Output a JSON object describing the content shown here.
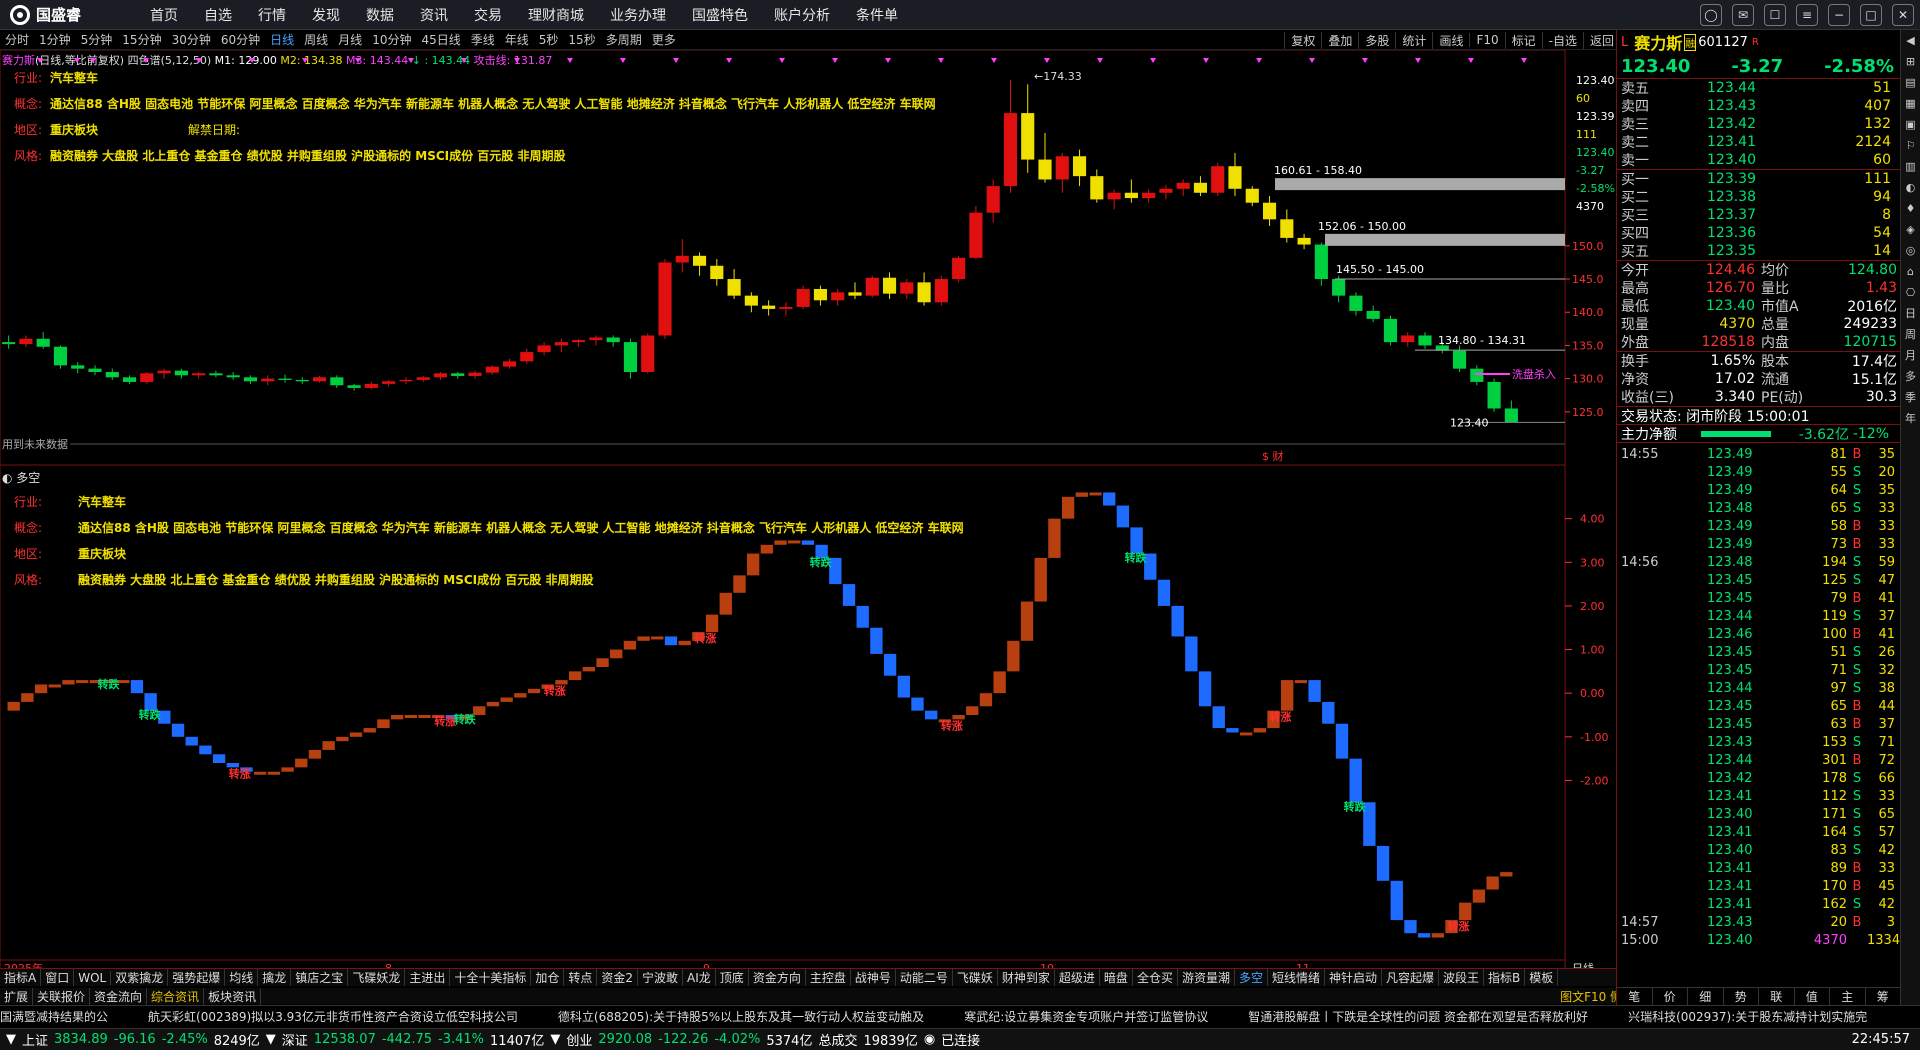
{
  "nav": {
    "logo": "国盛睿",
    "items": [
      "首页",
      "自选",
      "行情",
      "发现",
      "数据",
      "资讯",
      "交易",
      "理财商城",
      "业务办理",
      "国盛特色",
      "账户分析",
      "条件单"
    ]
  },
  "periods": {
    "items": [
      "分时",
      "1分钟",
      "5分钟",
      "15分钟",
      "30分钟",
      "60分钟",
      "日线",
      "周线",
      "月线",
      "10分钟",
      "45日线",
      "季线",
      "年线",
      "5秒",
      "15秒",
      "多周期",
      "更多"
    ],
    "active": "日线"
  },
  "tools": [
    "复权",
    "叠加",
    "多股",
    "统计",
    "画线",
    "F10",
    "标记",
    "-自选",
    "返回"
  ],
  "chart": {
    "legend": {
      "name": "赛力斯",
      "name_suffix": "(日线,等比前复权)",
      "indicator": "四色谱(5,12,50)",
      "m1": "M1: 129.00",
      "m2": "M2: 134.38",
      "m3": "M3: 143.44",
      "arrow": ": 143.44",
      "attack": "攻击线: 131.87"
    },
    "info": {
      "industry_label": "行业:",
      "industry": "汽车整车",
      "concept_label": "概念:",
      "concepts": "通达信88 含H股 固态电池 节能环保 阿里概念 百度概念 华为汽车 新能源车 机器人概念 无人驾驶 人工智能 地摊经济 抖音概念 飞行汽车 人形机器人 低空经济 车联网",
      "region_label": "地区:",
      "region": "重庆板块",
      "unlock_label": "解禁日期:",
      "style_label": "风格:",
      "style": "融资融券 大盘股 北上重仓 基金重仓 绩优股 并购重组股 沪股通标的 MSCI成份 百元股 非周期股"
    },
    "price_axis": [
      "150.0",
      "145.0",
      "140.0",
      "135.0",
      "130.0",
      "125.0"
    ],
    "top_axis": [
      "123.40",
      "60",
      "123.39",
      "111",
      "123.40",
      "-3.27",
      "-2.58%",
      "4370"
    ],
    "annotations": {
      "high": "174.33",
      "zone1": "160.61 - 158.40",
      "zone2": "152.06 - 150.00",
      "zone3": "145.50 - 145.00",
      "zone4": "134.80 - 134.31",
      "last": "123.40",
      "wash": "洗盘杀入",
      "future": "用到未来数据",
      "fin": "$ 财"
    },
    "sub": {
      "title": "多空",
      "axis": [
        "4.00",
        "3.00",
        "2.00",
        "1.00",
        "0.00",
        "-1.00",
        "-2.00"
      ],
      "rise": "转涨",
      "fall": "转跌"
    },
    "dates": {
      "year": "2025年",
      "m8": "8",
      "m9": "9",
      "m10": "10",
      "m11": "11",
      "period": "日线"
    }
  },
  "chart_data": {
    "type": "candlestick",
    "title": "赛力斯(日线,等比前复权)",
    "ohlc": [
      [
        135.5,
        136.5,
        134.5,
        135.2
      ],
      [
        135.2,
        136.5,
        134.8,
        136.0
      ],
      [
        136.0,
        137.0,
        134.5,
        134.8
      ],
      [
        134.8,
        135.0,
        131.5,
        132.0
      ],
      [
        132.0,
        132.5,
        130.8,
        131.5
      ],
      [
        131.5,
        132.0,
        130.5,
        131.0
      ],
      [
        131.0,
        131.5,
        129.8,
        130.2
      ],
      [
        130.2,
        130.5,
        129.2,
        129.5
      ],
      [
        129.5,
        131.0,
        129.2,
        130.8
      ],
      [
        130.8,
        131.5,
        130.0,
        131.2
      ],
      [
        131.2,
        131.5,
        130.0,
        130.5
      ],
      [
        130.5,
        131.0,
        130.0,
        130.8
      ],
      [
        130.8,
        131.2,
        130.2,
        130.5
      ],
      [
        130.5,
        131.0,
        129.8,
        130.2
      ],
      [
        130.2,
        130.5,
        129.2,
        129.6
      ],
      [
        129.6,
        130.5,
        129.0,
        130.0
      ],
      [
        130.0,
        130.6,
        129.4,
        129.8
      ],
      [
        129.8,
        130.2,
        129.2,
        129.6
      ],
      [
        129.6,
        130.4,
        129.4,
        130.2
      ],
      [
        130.2,
        130.5,
        128.6,
        129.0
      ],
      [
        129.0,
        129.2,
        128.2,
        128.6
      ],
      [
        128.6,
        129.5,
        128.4,
        129.2
      ],
      [
        129.2,
        129.8,
        128.8,
        129.6
      ],
      [
        129.6,
        130.2,
        129.2,
        129.8
      ],
      [
        129.8,
        130.4,
        129.5,
        130.2
      ],
      [
        130.2,
        131.0,
        129.8,
        130.8
      ],
      [
        130.8,
        131.0,
        130.0,
        130.4
      ],
      [
        130.4,
        131.2,
        130.0,
        130.9
      ],
      [
        130.9,
        132.0,
        130.6,
        131.8
      ],
      [
        131.8,
        133.0,
        131.5,
        132.6
      ],
      [
        132.6,
        134.5,
        132.2,
        134.0
      ],
      [
        134.0,
        135.5,
        133.5,
        135.0
      ],
      [
        135.0,
        136.0,
        134.0,
        135.5
      ],
      [
        135.5,
        136.0,
        134.8,
        135.8
      ],
      [
        135.8,
        136.5,
        135.0,
        136.2
      ],
      [
        136.2,
        136.5,
        134.8,
        135.5
      ],
      [
        135.5,
        136.0,
        130.0,
        131.0
      ],
      [
        131.0,
        136.8,
        130.8,
        136.5
      ],
      [
        136.5,
        148.0,
        136.0,
        147.5
      ],
      [
        147.5,
        151.0,
        146.0,
        148.5
      ],
      [
        148.5,
        149.0,
        145.5,
        147.0
      ],
      [
        147.0,
        148.0,
        144.0,
        145.0
      ],
      [
        145.0,
        146.5,
        142.0,
        142.5
      ],
      [
        142.5,
        143.0,
        140.0,
        141.0
      ],
      [
        141.0,
        141.8,
        139.5,
        140.5
      ],
      [
        140.5,
        141.5,
        139.5,
        140.8
      ],
      [
        140.8,
        144.0,
        140.5,
        143.5
      ],
      [
        143.5,
        144.0,
        141.0,
        141.8
      ],
      [
        141.8,
        143.5,
        141.0,
        143.0
      ],
      [
        143.0,
        144.5,
        142.0,
        142.5
      ],
      [
        142.5,
        145.5,
        142.2,
        145.2
      ],
      [
        145.2,
        146.0,
        142.0,
        142.8
      ],
      [
        142.8,
        145.0,
        142.0,
        144.5
      ],
      [
        144.5,
        146.0,
        141.0,
        141.5
      ],
      [
        141.5,
        145.5,
        141.0,
        145.0
      ],
      [
        145.0,
        148.5,
        144.5,
        148.2
      ],
      [
        148.2,
        156.0,
        148.0,
        155.0
      ],
      [
        155.0,
        160.0,
        153.5,
        159.0
      ],
      [
        159.0,
        175.0,
        158.0,
        170.0
      ],
      [
        170.0,
        174.33,
        161.0,
        163.0
      ],
      [
        163.0,
        167.0,
        159.5,
        160.0
      ],
      [
        160.0,
        164.0,
        158.0,
        163.5
      ],
      [
        163.5,
        164.5,
        159.0,
        160.5
      ],
      [
        160.5,
        161.5,
        156.5,
        157.0
      ],
      [
        157.0,
        158.5,
        155.5,
        158.0
      ],
      [
        158.0,
        160.0,
        156.5,
        157.2
      ],
      [
        157.2,
        158.5,
        156.5,
        158.0
      ],
      [
        158.0,
        159.2,
        157.0,
        158.6
      ],
      [
        158.6,
        160.0,
        157.5,
        159.5
      ],
      [
        159.5,
        160.5,
        157.5,
        158.0
      ],
      [
        158.0,
        162.5,
        157.5,
        162.0
      ],
      [
        162.0,
        164.0,
        157.5,
        158.6
      ],
      [
        158.6,
        159.0,
        156.0,
        156.5
      ],
      [
        156.5,
        157.5,
        153.0,
        154.0
      ],
      [
        154.0,
        155.5,
        150.5,
        151.2
      ],
      [
        151.2,
        151.8,
        149.5,
        150.2
      ],
      [
        150.2,
        150.5,
        144.0,
        145.0
      ],
      [
        145.0,
        145.5,
        141.5,
        142.5
      ],
      [
        142.5,
        143.0,
        139.5,
        140.2
      ],
      [
        140.2,
        141.0,
        138.5,
        139.0
      ],
      [
        139.0,
        139.5,
        135.0,
        135.5
      ],
      [
        135.5,
        137.0,
        134.8,
        136.5
      ],
      [
        136.5,
        137.0,
        134.5,
        135.0
      ],
      [
        135.0,
        135.5,
        133.8,
        134.2
      ],
      [
        134.2,
        135.0,
        131.0,
        131.5
      ],
      [
        131.5,
        132.0,
        129.0,
        129.5
      ],
      [
        129.5,
        130.0,
        125.0,
        125.5
      ],
      [
        125.5,
        126.7,
        123.4,
        123.4
      ]
    ],
    "price_range": [
      120,
      178
    ],
    "ma": {
      "M1": 129.0,
      "M2": 134.38,
      "M3": 143.44
    },
    "duokong": [
      -0.4,
      -0.2,
      0.0,
      0.2,
      0.2,
      0.3,
      0.3,
      0.3,
      0.3,
      0.3,
      0.0,
      -0.4,
      -0.7,
      -1.0,
      -1.2,
      -1.4,
      -1.6,
      -1.7,
      -1.8,
      -1.8,
      -1.8,
      -1.7,
      -1.5,
      -1.3,
      -1.1,
      -1.0,
      -0.9,
      -0.8,
      -0.6,
      -0.5,
      -0.5,
      -0.5,
      -0.5,
      -0.6,
      -0.5,
      -0.3,
      -0.2,
      -0.1,
      0.0,
      0.1,
      0.2,
      0.3,
      0.5,
      0.6,
      0.8,
      1.0,
      1.2,
      1.3,
      1.3,
      1.1,
      1.2,
      1.4,
      1.8,
      2.3,
      2.7,
      3.2,
      3.4,
      3.5,
      3.5,
      3.4,
      3.1,
      2.5,
      2.0,
      1.5,
      0.9,
      0.4,
      -0.1,
      -0.4,
      -0.6,
      -0.6,
      -0.5,
      -0.3,
      0.0,
      0.5,
      1.2,
      2.1,
      3.1,
      4.0,
      4.5,
      4.6,
      4.6,
      4.3,
      3.8,
      3.2,
      2.6,
      2.0,
      1.3,
      0.5,
      -0.3,
      -0.8,
      -0.9,
      -0.9,
      -0.8,
      -0.4,
      0.3,
      0.3,
      -0.2,
      -0.7,
      -1.5,
      -2.5,
      -3.5,
      -4.3,
      -5.2,
      -5.5,
      -5.6,
      -5.5,
      -5.2,
      -4.8,
      -4.5,
      -4.2,
      -4.1
    ],
    "duokong_range": [
      -6,
      5
    ],
    "rise_idx": [
      17,
      32,
      40,
      51,
      69,
      93,
      106
    ],
    "fall_idx": [
      8,
      11,
      34,
      60,
      83,
      99
    ]
  },
  "rpanel": {
    "name": "赛力斯",
    "code": "601127",
    "badge": "R",
    "badge2": "融",
    "price": "123.40",
    "chg": "-3.27",
    "pct": "-2.58%",
    "sell": [
      [
        "卖五",
        "123.44",
        "51"
      ],
      [
        "卖四",
        "123.43",
        "407"
      ],
      [
        "卖三",
        "123.42",
        "132"
      ],
      [
        "卖二",
        "123.41",
        "2124"
      ],
      [
        "卖一",
        "123.40",
        "60"
      ]
    ],
    "buy": [
      [
        "买一",
        "123.39",
        "111"
      ],
      [
        "买二",
        "123.38",
        "94"
      ],
      [
        "买三",
        "123.37",
        "8"
      ],
      [
        "买四",
        "123.36",
        "54"
      ],
      [
        "买五",
        "123.35",
        "14"
      ]
    ],
    "stats": [
      [
        "今开",
        "124.46",
        "均价",
        "124.80"
      ],
      [
        "最高",
        "126.70",
        "量比",
        "1.43"
      ],
      [
        "最低",
        "123.40",
        "市值A",
        "2016亿"
      ],
      [
        "现量",
        "4370",
        "总量",
        "249233"
      ],
      [
        "外盘",
        "128518",
        "内盘",
        "120715"
      ],
      [
        "换手",
        "1.65%",
        "股本",
        "17.4亿"
      ],
      [
        "净资",
        "17.02",
        "流通",
        "15.1亿"
      ],
      [
        "收益(三)",
        "3.340",
        "PE(动)",
        "30.3"
      ]
    ],
    "trade_state": "交易状态: 闭市阶段 15:00:01",
    "main_flow_label": "主力净额",
    "main_flow": "-3.62亿",
    "main_flow_pct": "-12%",
    "ticks": [
      [
        "14:55",
        "123.49",
        "81",
        "B",
        "35"
      ],
      [
        "",
        "123.49",
        "55",
        "S",
        "20"
      ],
      [
        "",
        "123.49",
        "64",
        "S",
        "35"
      ],
      [
        "",
        "123.48",
        "65",
        "S",
        "33"
      ],
      [
        "",
        "123.49",
        "58",
        "B",
        "33"
      ],
      [
        "",
        "123.49",
        "73",
        "B",
        "33"
      ],
      [
        "14:56",
        "123.48",
        "194",
        "S",
        "59"
      ],
      [
        "",
        "123.45",
        "125",
        "S",
        "47"
      ],
      [
        "",
        "123.45",
        "79",
        "B",
        "41"
      ],
      [
        "",
        "123.44",
        "119",
        "S",
        "37"
      ],
      [
        "",
        "123.46",
        "100",
        "B",
        "41"
      ],
      [
        "",
        "123.45",
        "51",
        "S",
        "26"
      ],
      [
        "",
        "123.45",
        "71",
        "S",
        "32"
      ],
      [
        "",
        "123.44",
        "97",
        "S",
        "38"
      ],
      [
        "",
        "123.45",
        "65",
        "B",
        "44"
      ],
      [
        "",
        "123.45",
        "63",
        "B",
        "37"
      ],
      [
        "",
        "123.43",
        "153",
        "S",
        "71"
      ],
      [
        "",
        "123.44",
        "301",
        "B",
        "72"
      ],
      [
        "",
        "123.42",
        "178",
        "S",
        "66"
      ],
      [
        "",
        "123.41",
        "112",
        "S",
        "33"
      ],
      [
        "",
        "123.40",
        "171",
        "S",
        "65"
      ],
      [
        "",
        "123.41",
        "164",
        "S",
        "57"
      ],
      [
        "",
        "123.40",
        "83",
        "S",
        "42"
      ],
      [
        "",
        "123.41",
        "89",
        "B",
        "33"
      ],
      [
        "",
        "123.41",
        "170",
        "B",
        "45"
      ],
      [
        "",
        "123.41",
        "162",
        "S",
        "42"
      ],
      [
        "14:57",
        "123.43",
        "20",
        "B",
        "3"
      ],
      [
        "15:00",
        "123.40",
        "4370",
        "",
        "1334"
      ]
    ],
    "bottom": [
      "笔",
      "价",
      "细",
      "势",
      "联",
      "值",
      "主",
      "筹"
    ]
  },
  "sidebar": [
    "日",
    "周",
    "月",
    "多",
    "季",
    "年"
  ],
  "bottomtabs": [
    "指标A",
    "窗口",
    "WOL",
    "双紫擒龙",
    "强势起爆",
    "均线",
    "擒龙",
    "镇店之宝",
    "飞碟妖龙",
    "主进出",
    "十全十美指标",
    "加仓",
    "转点",
    "资金2",
    "宁波敢",
    "AI龙",
    "顶底",
    "资金方向",
    "主控盘",
    "战神号",
    "动能二号",
    "飞碟妖",
    "财神到家",
    "超级进",
    "暗盘",
    "全仓买",
    "游资量潮",
    "多空",
    "短线情绪",
    "神针启动",
    "凡容起爆",
    "波段王",
    "指标B",
    "模板"
  ],
  "bottomtab_active": "多空",
  "subtabs": [
    "扩展",
    "关联报价",
    "资金流向",
    "综合资讯",
    "板块资讯"
  ],
  "subtab_active": "综合资讯",
  "subtab_right": "图文F10 侧边栏",
  "ticker": [
    "国满暨减持结果的公",
    "航天彩虹(002389)拟以3.93亿元非货币性资产合资设立低空科技公司",
    "德科立(688205):关于持股5%以上股东及其一致行动人权益变动触及",
    "寒武纪:设立募集资金专项账户并签订监管协议",
    "智通港股解盘丨下跌是全球性的问题 资金都在观望是否释放利好",
    "兴瑞科技(002937):关于股东减持计划实施完"
  ],
  "status": {
    "sh_label": "上证",
    "sh": "3834.89",
    "sh_chg": "-96.16",
    "sh_pct": "-2.45%",
    "sh_amt": "8249亿",
    "sz_label": "深证",
    "sz": "12538.07",
    "sz_chg": "-442.75",
    "sz_pct": "-3.41%",
    "sz_amt": "11407亿",
    "cy_label": "创业",
    "cy": "2920.08",
    "cy_chg": "-122.26",
    "cy_pct": "-4.02%",
    "cy_amt": "5374亿",
    "total_label": "总成交",
    "total": "19839亿",
    "conn": "已连接",
    "time": "22:45:57"
  }
}
